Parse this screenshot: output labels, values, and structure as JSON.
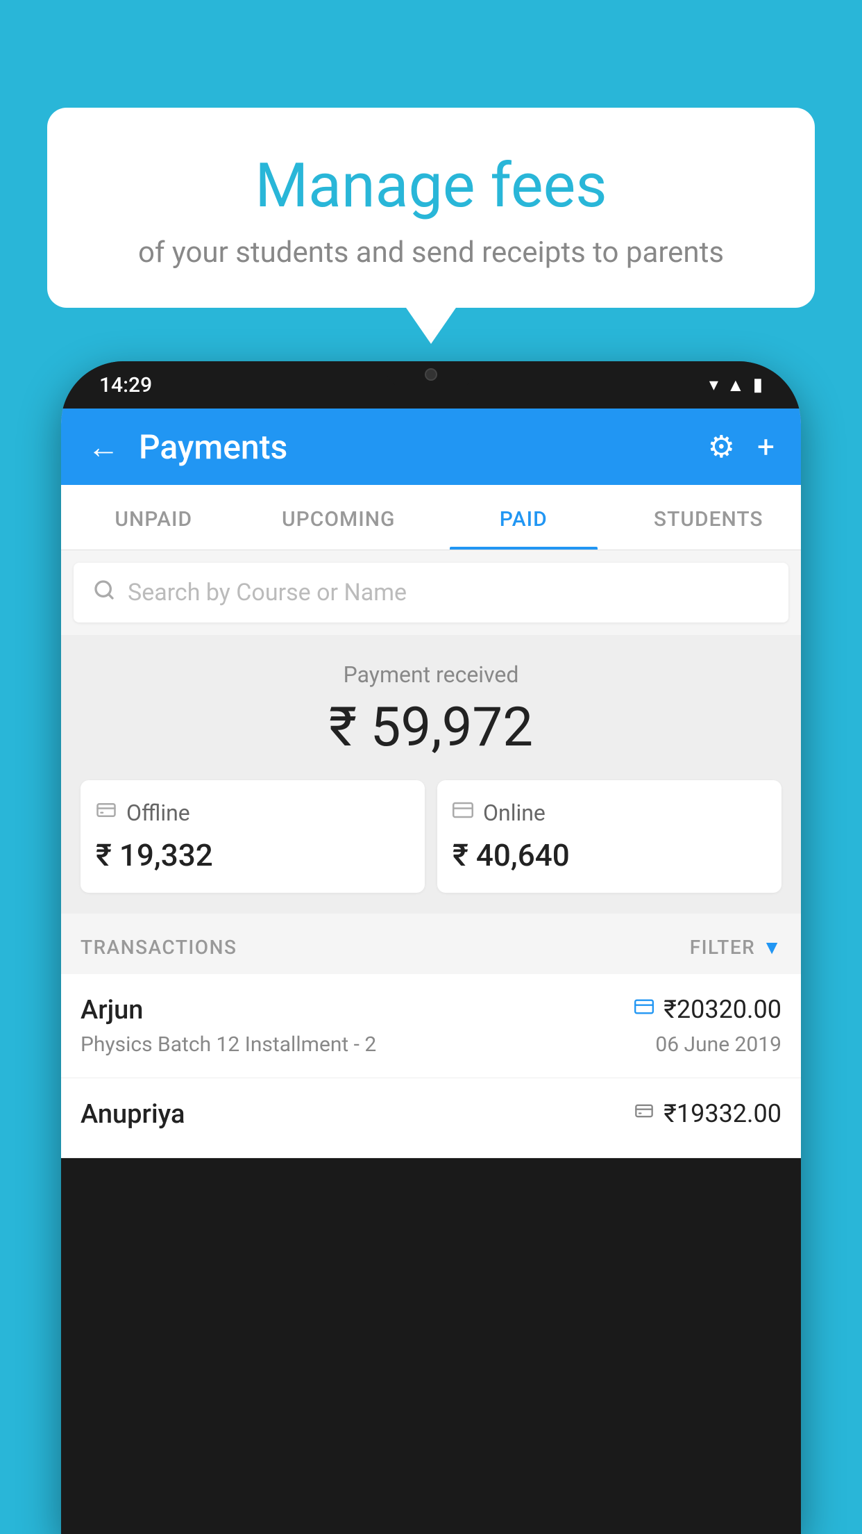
{
  "background_color": "#29b6d8",
  "bubble": {
    "title": "Manage fees",
    "subtitle": "of your students and send receipts to parents"
  },
  "phone": {
    "status_time": "14:29",
    "header": {
      "title": "Payments",
      "back_label": "←",
      "settings_label": "⚙",
      "add_label": "+"
    },
    "tabs": [
      {
        "label": "UNPAID",
        "active": false
      },
      {
        "label": "UPCOMING",
        "active": false
      },
      {
        "label": "PAID",
        "active": true
      },
      {
        "label": "STUDENTS",
        "active": false
      }
    ],
    "search": {
      "placeholder": "Search by Course or Name"
    },
    "payment_received": {
      "label": "Payment received",
      "amount": "₹ 59,972",
      "offline": {
        "type": "Offline",
        "amount": "₹ 19,332"
      },
      "online": {
        "type": "Online",
        "amount": "₹ 40,640"
      }
    },
    "transactions": {
      "header_label": "TRANSACTIONS",
      "filter_label": "FILTER",
      "items": [
        {
          "name": "Arjun",
          "amount": "₹20320.00",
          "detail": "Physics Batch 12 Installment - 2",
          "date": "06 June 2019",
          "payment_type": "online"
        },
        {
          "name": "Anupriya",
          "amount": "₹19332.00",
          "detail": "",
          "date": "",
          "payment_type": "offline"
        }
      ]
    }
  }
}
